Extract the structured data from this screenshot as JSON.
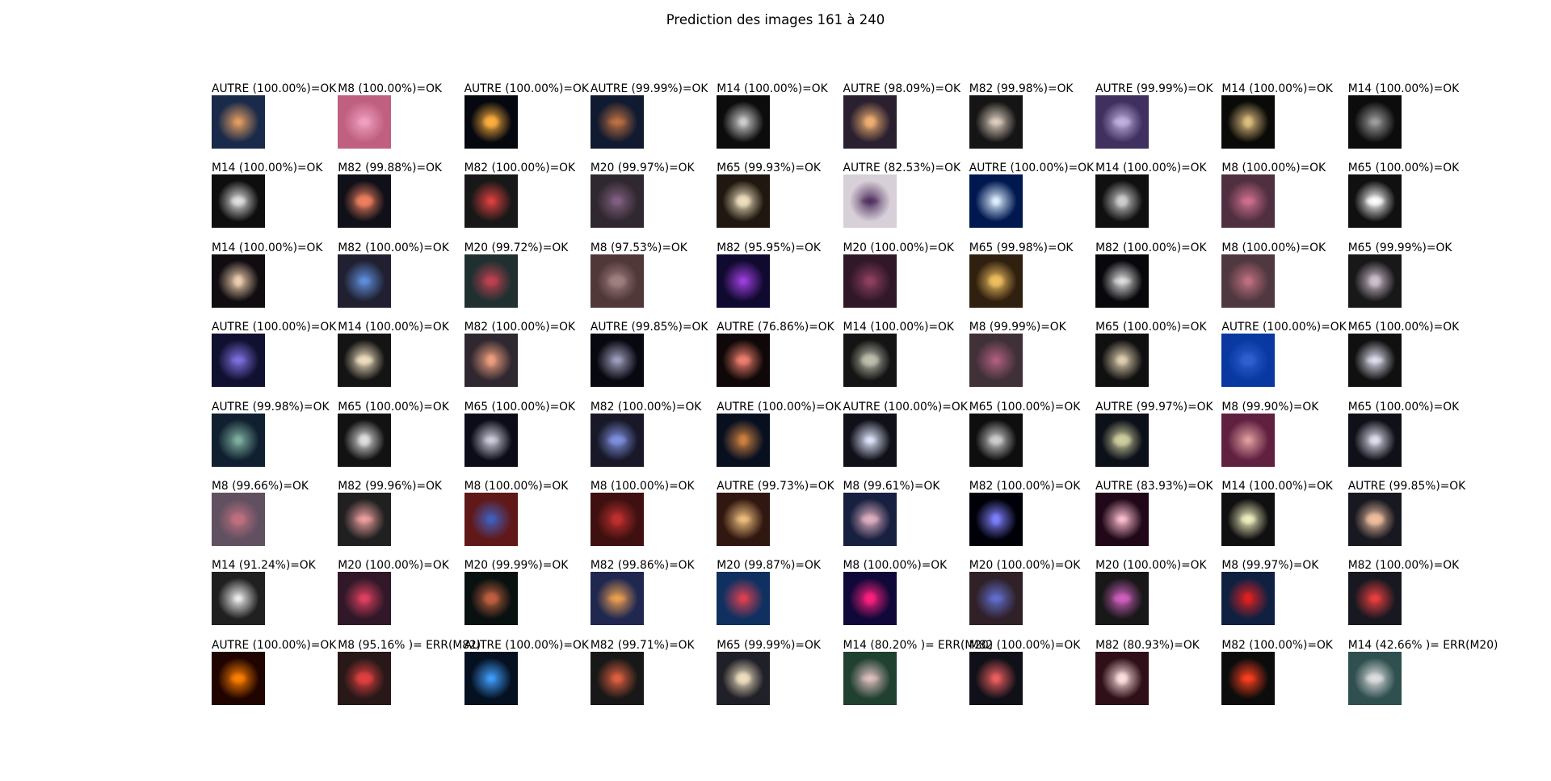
{
  "title": "Prediction des images 161 à 240",
  "items": [
    {
      "label": "AUTRE (100.00%)=OK",
      "icon": "spiral-galaxy-thumbnail",
      "bg": "#1a2a4a",
      "glow": "#e8a060"
    },
    {
      "label": "M8 (100.00%)=OK",
      "icon": "pink-nebula-thumbnail",
      "bg": "#c06080",
      "glow": "#f0a0c0"
    },
    {
      "label": "AUTRE (100.00%)=OK",
      "icon": "planet-sunrise-thumbnail",
      "bg": "#05080f",
      "glow": "#ffb040"
    },
    {
      "label": "AUTRE (99.99%)=OK",
      "icon": "planet-horizon-thumbnail",
      "bg": "#101a30",
      "glow": "#c07040"
    },
    {
      "label": "M14 (100.00%)=OK",
      "icon": "globular-cluster-thumbnail",
      "bg": "#0c0c0c",
      "glow": "#d0d0d0"
    },
    {
      "label": "AUTRE (98.09%)=OK",
      "icon": "milky-way-thumbnail",
      "bg": "#2a2030",
      "glow": "#f0b070"
    },
    {
      "label": "M82 (99.98%)=OK",
      "icon": "cigar-galaxy-thumbnail",
      "bg": "#151515",
      "glow": "#e0d0c0"
    },
    {
      "label": "AUTRE (99.99%)=OK",
      "icon": "milky-way-thumbnail",
      "bg": "#403060",
      "glow": "#c0b0e0"
    },
    {
      "label": "M14 (100.00%)=OK",
      "icon": "globular-cluster-thumbnail",
      "bg": "#0a0a08",
      "glow": "#e0c080"
    },
    {
      "label": "M14 (100.00%)=OK",
      "icon": "globular-cluster-thumbnail",
      "bg": "#0c0c0c",
      "glow": "#a0a0a0"
    },
    {
      "label": "M14 (100.00%)=OK",
      "icon": "globular-cluster-thumbnail",
      "bg": "#0e0e0e",
      "glow": "#e0e0e0"
    },
    {
      "label": "M82 (99.88%)=OK",
      "icon": "cigar-galaxy-thumbnail",
      "bg": "#101018",
      "glow": "#f08060"
    },
    {
      "label": "M82 (100.00%)=OK",
      "icon": "cigar-galaxy-thumbnail",
      "bg": "#181818",
      "glow": "#e04040"
    },
    {
      "label": "M20 (99.97%)=OK",
      "icon": "trifid-nebula-thumbnail",
      "bg": "#302830",
      "glow": "#806080"
    },
    {
      "label": "M65 (99.93%)=OK",
      "icon": "spiral-galaxy-thumbnail",
      "bg": "#201810",
      "glow": "#f0e0c0"
    },
    {
      "label": "AUTRE (82.53%)=OK",
      "icon": "space-poster-thumbnail",
      "bg": "#d8d0d8",
      "glow": "#503060"
    },
    {
      "label": "AUTRE (100.00%)=OK",
      "icon": "blue-planet-thumbnail",
      "bg": "#001850",
      "glow": "#e0f0ff"
    },
    {
      "label": "M14 (100.00%)=OK",
      "icon": "globular-cluster-thumbnail",
      "bg": "#101010",
      "glow": "#d0d0d0"
    },
    {
      "label": "M8 (100.00%)=OK",
      "icon": "pink-nebula-thumbnail",
      "bg": "#503040",
      "glow": "#d07090"
    },
    {
      "label": "M65 (100.00%)=OK",
      "icon": "spiral-galaxy-thumbnail",
      "bg": "#101010",
      "glow": "#ffffff"
    },
    {
      "label": "M14 (100.00%)=OK",
      "icon": "globular-cluster-thumbnail",
      "bg": "#100c10",
      "glow": "#f0d0b0"
    },
    {
      "label": "M82 (100.00%)=OK",
      "icon": "cigar-galaxy-thumbnail",
      "bg": "#202030",
      "glow": "#6090e0"
    },
    {
      "label": "M20 (99.72%)=OK",
      "icon": "trifid-nebula-thumbnail",
      "bg": "#203030",
      "glow": "#c04050"
    },
    {
      "label": "M8 (97.53%)=OK",
      "icon": "pink-nebula-thumbnail",
      "bg": "#503838",
      "glow": "#a08080"
    },
    {
      "label": "M82 (95.95%)=OK",
      "icon": "cigar-galaxy-thumbnail",
      "bg": "#100a30",
      "glow": "#a040e0"
    },
    {
      "label": "M20 (100.00%)=OK",
      "icon": "trifid-nebula-thumbnail",
      "bg": "#301828",
      "glow": "#904060"
    },
    {
      "label": "M65 (99.98%)=OK",
      "icon": "spiral-galaxy-thumbnail",
      "bg": "#302010",
      "glow": "#f0c060"
    },
    {
      "label": "M82 (100.00%)=OK",
      "icon": "cigar-galaxy-thumbnail",
      "bg": "#08080c",
      "glow": "#e0e0e0"
    },
    {
      "label": "M8 (100.00%)=OK",
      "icon": "pink-nebula-thumbnail",
      "bg": "#503840",
      "glow": "#c07080"
    },
    {
      "label": "M65 (99.99%)=OK",
      "icon": "spiral-galaxy-thumbnail",
      "bg": "#181818",
      "glow": "#d0c0d0"
    },
    {
      "label": "AUTRE (100.00%)=OK",
      "icon": "space-scene-thumbnail",
      "bg": "#101030",
      "glow": "#8070e0"
    },
    {
      "label": "M14 (100.00%)=OK",
      "icon": "globular-cluster-thumbnail",
      "bg": "#141414",
      "glow": "#f0e0c0"
    },
    {
      "label": "M82 (100.00%)=OK",
      "icon": "cigar-galaxy-thumbnail",
      "bg": "#302830",
      "glow": "#f0a080"
    },
    {
      "label": "AUTRE (99.85%)=OK",
      "icon": "galaxy-group-thumbnail",
      "bg": "#080810",
      "glow": "#a0a0c0"
    },
    {
      "label": "AUTRE (76.86%)=OK",
      "icon": "ring-galaxy-thumbnail",
      "bg": "#100808",
      "glow": "#f08070"
    },
    {
      "label": "M14 (100.00%)=OK",
      "icon": "globular-cluster-thumbnail",
      "bg": "#141414",
      "glow": "#c0c0b0"
    },
    {
      "label": "M8 (99.99%)=OK",
      "icon": "pink-nebula-thumbnail",
      "bg": "#403038",
      "glow": "#b06080"
    },
    {
      "label": "M65 (100.00%)=OK",
      "icon": "spiral-galaxy-thumbnail",
      "bg": "#101010",
      "glow": "#e0d0b0"
    },
    {
      "label": "AUTRE (100.00%)=OK",
      "icon": "blue-starfield-thumbnail",
      "bg": "#0838a0",
      "glow": "#3060d0"
    },
    {
      "label": "M65 (100.00%)=OK",
      "icon": "spiral-galaxy-thumbnail",
      "bg": "#101010",
      "glow": "#e0e0f0"
    },
    {
      "label": "AUTRE (99.98%)=OK",
      "icon": "earth-thumbnail",
      "bg": "#102030",
      "glow": "#80b0a0"
    },
    {
      "label": "M65 (100.00%)=OK",
      "icon": "spiral-galaxy-thumbnail",
      "bg": "#121212",
      "glow": "#e0e0e0"
    },
    {
      "label": "M65 (100.00%)=OK",
      "icon": "spiral-galaxy-thumbnail",
      "bg": "#0c0c18",
      "glow": "#d0d0e0"
    },
    {
      "label": "M82 (100.00%)=OK",
      "icon": "cigar-galaxy-thumbnail",
      "bg": "#181828",
      "glow": "#8090e0"
    },
    {
      "label": "AUTRE (100.00%)=OK",
      "icon": "planet-horizon-thumbnail",
      "bg": "#081020",
      "glow": "#d08040"
    },
    {
      "label": "AUTRE (100.00%)=OK",
      "icon": "spiral-galaxy-thumbnail",
      "bg": "#101018",
      "glow": "#e0e8ff"
    },
    {
      "label": "M65 (100.00%)=OK",
      "icon": "spiral-galaxy-thumbnail",
      "bg": "#0e0e0e",
      "glow": "#d0d0d0"
    },
    {
      "label": "AUTRE (99.97%)=OK",
      "icon": "moon-thumbnail",
      "bg": "#0c1018",
      "glow": "#d0d0a0"
    },
    {
      "label": "M8 (99.90%)=OK",
      "icon": "pink-nebula-thumbnail",
      "bg": "#602040",
      "glow": "#e0a0a0"
    },
    {
      "label": "M65 (100.00%)=OK",
      "icon": "spiral-galaxy-thumbnail",
      "bg": "#101018",
      "glow": "#e0e0f0"
    },
    {
      "label": "M8 (99.66%)=OK",
      "icon": "pink-nebula-thumbnail",
      "bg": "#605060",
      "glow": "#c07080"
    },
    {
      "label": "M82 (99.96%)=OK",
      "icon": "cigar-galaxy-thumbnail",
      "bg": "#202020",
      "glow": "#f0a0a0"
    },
    {
      "label": "M8 (100.00%)=OK",
      "icon": "pink-nebula-thumbnail",
      "bg": "#601818",
      "glow": "#4060c0"
    },
    {
      "label": "M8 (100.00%)=OK",
      "icon": "pink-nebula-thumbnail",
      "bg": "#401010",
      "glow": "#c03030"
    },
    {
      "label": "AUTRE (99.73%)=OK",
      "icon": "spiral-galaxy-thumbnail",
      "bg": "#301810",
      "glow": "#f0c080"
    },
    {
      "label": "M8 (99.61%)=OK",
      "icon": "pink-nebula-thumbnail",
      "bg": "#182040",
      "glow": "#e0b0c0"
    },
    {
      "label": "M82 (100.00%)=OK",
      "icon": "cigar-galaxy-thumbnail",
      "bg": "#000008",
      "glow": "#8080ff"
    },
    {
      "label": "AUTRE (83.93%)=OK",
      "icon": "red-star-thumbnail",
      "bg": "#200818",
      "glow": "#ffc0d0"
    },
    {
      "label": "M14 (100.00%)=OK",
      "icon": "globular-cluster-thumbnail",
      "bg": "#101010",
      "glow": "#f0f0c0"
    },
    {
      "label": "AUTRE (99.85%)=OK",
      "icon": "spiral-galaxy-thumbnail",
      "bg": "#181820",
      "glow": "#f0c0a0"
    },
    {
      "label": "M14 (91.24%)=OK",
      "icon": "globular-cluster-thumbnail",
      "bg": "#202020",
      "glow": "#f0f0f0"
    },
    {
      "label": "M20 (100.00%)=OK",
      "icon": "trifid-nebula-thumbnail",
      "bg": "#301828",
      "glow": "#e04060"
    },
    {
      "label": "M20 (99.99%)=OK",
      "icon": "trifid-nebula-thumbnail",
      "bg": "#081010",
      "glow": "#c06040"
    },
    {
      "label": "M82 (99.86%)=OK",
      "icon": "cigar-galaxy-thumbnail",
      "bg": "#202850",
      "glow": "#f0a050"
    },
    {
      "label": "M20 (99.87%)=OK",
      "icon": "trifid-nebula-thumbnail",
      "bg": "#103060",
      "glow": "#e04050"
    },
    {
      "label": "M8 (100.00%)=OK",
      "icon": "pink-nebula-thumbnail",
      "bg": "#100838",
      "glow": "#ff2080"
    },
    {
      "label": "M20 (100.00%)=OK",
      "icon": "trifid-nebula-thumbnail",
      "bg": "#302028",
      "glow": "#6070d0"
    },
    {
      "label": "M20 (100.00%)=OK",
      "icon": "trifid-nebula-thumbnail",
      "bg": "#181818",
      "glow": "#d060c0"
    },
    {
      "label": "M8 (99.97%)=OK",
      "icon": "pink-nebula-thumbnail",
      "bg": "#102040",
      "glow": "#e02020"
    },
    {
      "label": "M82 (100.00%)=OK",
      "icon": "cigar-galaxy-thumbnail",
      "bg": "#181820",
      "glow": "#f04040"
    },
    {
      "label": "AUTRE (100.00%)=OK",
      "icon": "black-hole-thumbnail",
      "bg": "#200400",
      "glow": "#ff8000"
    },
    {
      "label": "M8 (95.16% )= ERR(M82)",
      "icon": "cigar-galaxy-thumbnail",
      "bg": "#281818",
      "glow": "#e04040"
    },
    {
      "label": "AUTRE (100.00%)=OK",
      "icon": "aurora-thumbnail",
      "bg": "#051020",
      "glow": "#40a0ff"
    },
    {
      "label": "M82 (99.71%)=OK",
      "icon": "cigar-galaxy-thumbnail",
      "bg": "#181818",
      "glow": "#e06040"
    },
    {
      "label": "M65 (99.99%)=OK",
      "icon": "spiral-galaxy-thumbnail",
      "bg": "#202028",
      "glow": "#f0e0c0"
    },
    {
      "label": "M14 (80.20% )= ERR(M20)",
      "icon": "trifid-nebula-thumbnail",
      "bg": "#204030",
      "glow": "#e0c0c0"
    },
    {
      "label": "M82 (100.00%)=OK",
      "icon": "cigar-galaxy-thumbnail",
      "bg": "#101018",
      "glow": "#f06060"
    },
    {
      "label": "M82 (80.93%)=OK",
      "icon": "cigar-galaxy-thumbnail",
      "bg": "#301018",
      "glow": "#ffe0e0"
    },
    {
      "label": "M82 (100.00%)=OK",
      "icon": "cigar-galaxy-thumbnail",
      "bg": "#0c0c0c",
      "glow": "#ff4020"
    },
    {
      "label": "M14 (42.66% )= ERR(M20)",
      "icon": "trifid-nebula-thumbnail",
      "bg": "#305050",
      "glow": "#e0e0e0"
    }
  ]
}
